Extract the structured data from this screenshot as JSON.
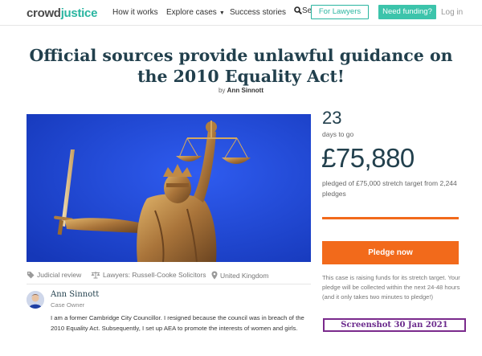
{
  "nav": {
    "logo_part1": "crowd",
    "logo_part2": "justice",
    "how_it_works": "How it works",
    "explore_cases": "Explore cases",
    "success_stories": "Success stories",
    "search_label": "Se",
    "for_lawyers": "For Lawyers",
    "need_funding": "Need funding?",
    "login": "Log in"
  },
  "case": {
    "title": "Official sources provide unlawful guidance on the 2010 Equality Act!",
    "byline_prefix": "by",
    "author": "Ann Sinnott"
  },
  "stats": {
    "days_left": "23",
    "days_label": "days to go",
    "amount": "£75,880",
    "pledged_text": "pledged of £75,000 stretch target from 2,244 pledges",
    "progress_fraction": 1.0
  },
  "pledge": {
    "button_label": "Pledge now",
    "note": "This case is raising funds for its stretch target. Your pledge will be collected within the next 24-48 hours (and it only takes two minutes to pledge!)"
  },
  "stamp": {
    "text": "Screenshot 30 Jan 2021"
  },
  "tags": {
    "category": "Judicial review",
    "lawyers": "Lawyers: Russell-Cooke Solicitors",
    "location": "United Kingdom"
  },
  "owner": {
    "name": "Ann Sinnott",
    "role": "Case Owner",
    "bio": "I am a former Cambridge City Councillor. I resigned because the council was in breach of the 2010 Equality Act. Subsequently, I set up AEA to promote the interests of women and girls."
  },
  "icons": {
    "search": "search-icon",
    "tag": "tag-icon",
    "scales": "scales-icon",
    "location": "location-pin-icon",
    "caret": "chevron-down-icon"
  },
  "colors": {
    "brand_teal": "#2ab5a0",
    "pledge_orange": "#f26a1b",
    "heading_navy": "#22404d",
    "stamp_purple": "#6b2a8c",
    "hero_blue": "#1f45cc"
  }
}
